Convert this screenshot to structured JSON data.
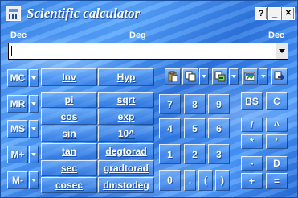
{
  "window": {
    "title": "Scientific calculator"
  },
  "titlebar_buttons": [
    "?",
    "_",
    "✕"
  ],
  "modes": {
    "left": "Dec",
    "center": "Deg",
    "right": "Dec"
  },
  "display": {
    "value": ""
  },
  "memory": [
    "MC",
    "MR",
    "MS",
    "M+",
    "M-"
  ],
  "functions": {
    "inv": "Inv",
    "hyp": "Hyp",
    "left": [
      "pi",
      "cos",
      "sin",
      "tan",
      "sec",
      "cosec"
    ],
    "right": [
      "sqrt",
      "exp",
      "10^",
      "degtorad",
      "gradtorad",
      "dmstodeg"
    ]
  },
  "digits": [
    "7",
    "8",
    "9",
    "4",
    "5",
    "6",
    "1",
    "2",
    "3",
    "0",
    ".",
    "(",
    ")"
  ],
  "ops": [
    "BS",
    "C",
    "/",
    "^",
    "*",
    "'",
    "-",
    "D",
    "+",
    "="
  ],
  "toolbar_icons": [
    "paste-icon",
    "copy-icon",
    "history-icon",
    "chart-icon",
    "export-icon"
  ]
}
